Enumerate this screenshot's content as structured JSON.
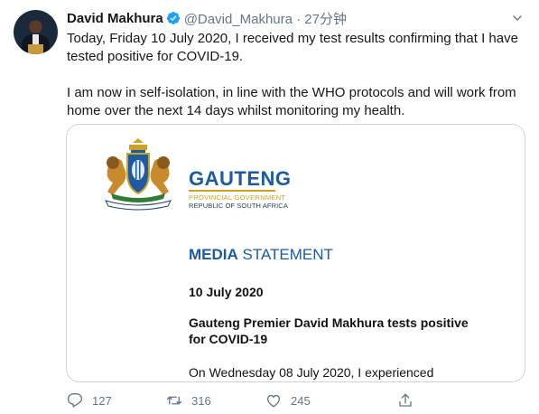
{
  "tweet": {
    "author_name": "David Makhura",
    "author_handle": "@David_Makhura · 27分钟",
    "text_para1": "Today, Friday 10 July 2020, I received my test results confirming that I have tested positive for COVID-19.",
    "text_para2": "I am now in self-isolation, in line with the WHO protocols and will work from home over the next 14 days whilst monitoring my health."
  },
  "media": {
    "brand_title": "GAUTENG",
    "brand_line1": "PROVINCIAL GOVERNMENT",
    "brand_line2": "REPUBLIC OF SOUTH AFRICA",
    "statement_word1": "MEDIA",
    "statement_word2": " STATEMENT",
    "date": "10 July 2020",
    "headline": "Gauteng Premier David Makhura tests positive for COVID-19",
    "body": "On Wednesday 08 July 2020, I experienced"
  },
  "actions": {
    "replies": "127",
    "retweets": "316",
    "likes": "245"
  },
  "colors": {
    "verified": "#1da1f2",
    "brand_blue": "#1d5aa0",
    "brand_gold": "#c9a227",
    "meta_grey": "#657786"
  },
  "icons": [
    "verified-badge-icon",
    "chevron-down-icon",
    "reply-icon",
    "retweet-icon",
    "like-icon",
    "share-icon",
    "coat-of-arms-icon"
  ]
}
